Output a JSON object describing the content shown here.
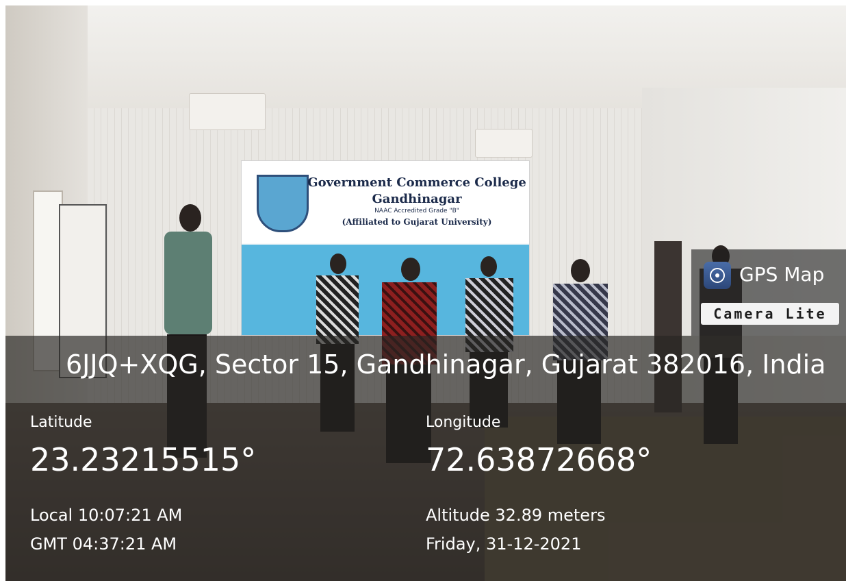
{
  "photo": {
    "banner_title": "Government Commerce College Gandhinagar",
    "banner_grade": "NAAC Accredited Grade \"B\"",
    "banner_affiliation": "(Affiliated to Gujarat University)"
  },
  "badge": {
    "app_name": "GPS Map",
    "app_sub": "Camera Lite",
    "icon": "camera-lens-icon"
  },
  "location": {
    "address": "6JJQ+XQG, Sector 15, Gandhinagar, Gujarat 382016, India",
    "latitude_label": "Latitude",
    "latitude_value": "23.23215515°",
    "longitude_label": "Longitude",
    "longitude_value": "72.63872668°",
    "local_time": "Local 10:07:21 AM",
    "gmt_time": "GMT 04:37:21 AM",
    "altitude": "Altitude 32.89 meters",
    "date": "Friday, 31-12-2021"
  },
  "colors": {
    "overlay": "#282624",
    "banner_blue": "#57b6de"
  }
}
